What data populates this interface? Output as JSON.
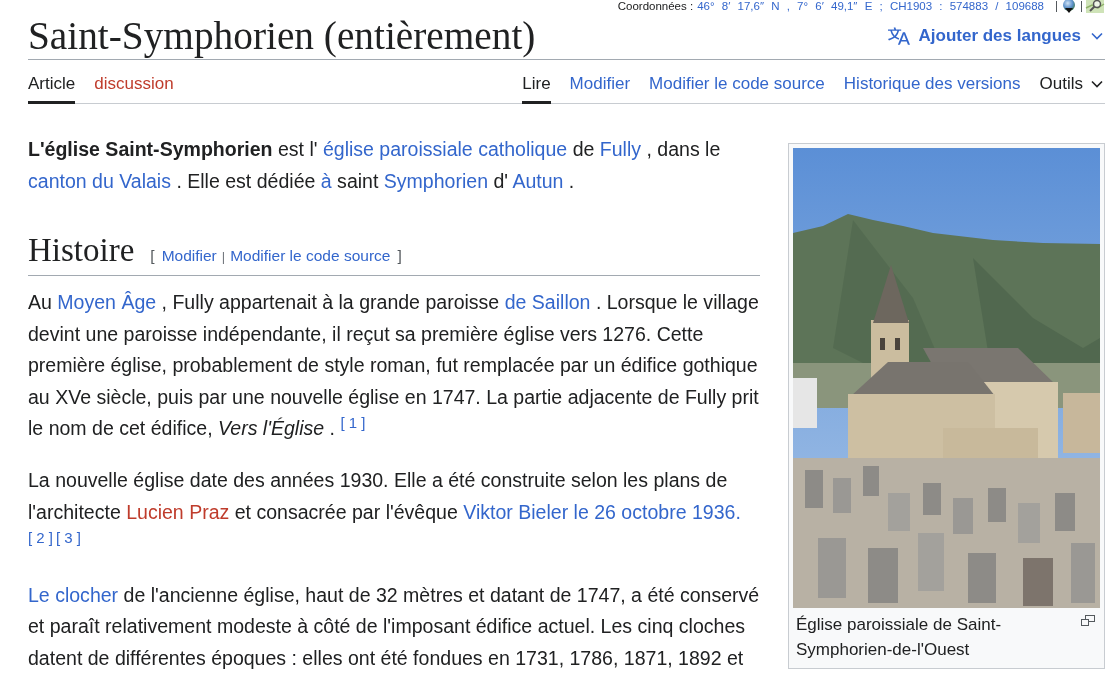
{
  "coordinates": {
    "label": "Coordonnées :",
    "value": "46° 8′ 17,6″ N , 7° 6′ 49,1″ E ; CH1903 : 574883 / 109688"
  },
  "header": {
    "title": "Saint-Symphorien (entièrement)",
    "languages_button": "Ajouter des langues"
  },
  "namespace_tabs": [
    {
      "label": "Article",
      "selected": true,
      "missing": false
    },
    {
      "label": "discussion",
      "selected": false,
      "missing": true
    }
  ],
  "view_tabs": [
    {
      "label": "Lire",
      "selected": true
    },
    {
      "label": "Modifier",
      "selected": false
    },
    {
      "label": "Modifier le code source",
      "selected": false
    },
    {
      "label": "Historique des versions",
      "selected": false
    }
  ],
  "tools_menu": {
    "label": "Outils"
  },
  "content": [
    {
      "kind": "paragraph",
      "segments": [
        {
          "kind": "bold",
          "text": "L'église Saint-Symphorien"
        },
        {
          "kind": "text",
          "text": " est l' "
        },
        {
          "kind": "link",
          "text": "église paroissiale catholique"
        },
        {
          "kind": "text",
          "text": " de "
        },
        {
          "kind": "link",
          "text": "Fully"
        },
        {
          "kind": "text",
          "text": " , dans le "
        },
        {
          "kind": "link",
          "text": "canton du Valais"
        },
        {
          "kind": "text",
          "text": " . Elle est dédiée "
        },
        {
          "kind": "link",
          "text": "à"
        },
        {
          "kind": "text",
          "text": " saint "
        },
        {
          "kind": "link",
          "text": "Symphorien"
        },
        {
          "kind": "text",
          "text": " d' "
        },
        {
          "kind": "link",
          "text": "Autun"
        },
        {
          "kind": "text",
          "text": " ."
        }
      ]
    },
    {
      "kind": "heading",
      "title": "Histoire",
      "bracket_open": "[",
      "edit_links": [
        "Modifier",
        "Modifier le code source"
      ],
      "separator": "|",
      "bracket_close": "]"
    },
    {
      "kind": "paragraph",
      "segments": [
        {
          "kind": "text",
          "text": "Au "
        },
        {
          "kind": "link",
          "text": "Moyen Âge"
        },
        {
          "kind": "text",
          "text": " , Fully appartenait à la grande paroisse "
        },
        {
          "kind": "link",
          "text": "de Saillon"
        },
        {
          "kind": "text",
          "text": " . Lorsque le village devint une paroisse indépendante, il reçut sa première église vers 1276. Cette première église, probablement de style roman, fut remplacée par un édifice gothique au XVe siècle, puis par une nouvelle église en 1747. La partie adjacente de Fully prit le nom de cet édifice, "
        },
        {
          "kind": "italic",
          "text": "Vers l'Église"
        },
        {
          "kind": "text",
          "text": " . "
        },
        {
          "kind": "ref",
          "text": "[ 1 ]"
        }
      ]
    },
    {
      "kind": "paragraph",
      "segments": [
        {
          "kind": "text",
          "text": "La nouvelle église date des années 1930. Elle a été construite selon les plans de l'architecte "
        },
        {
          "kind": "redlink",
          "text": "Lucien Praz"
        },
        {
          "kind": "text",
          "text": " et consacrée par l'évêque "
        },
        {
          "kind": "link",
          "text": "Viktor Bieler le 26 octobre 1936."
        },
        {
          "kind": "ref",
          "text": "[ 2 ]"
        },
        {
          "kind": "ref",
          "text": "[ 3 ]"
        }
      ]
    },
    {
      "kind": "paragraph",
      "segments": [
        {
          "kind": "link",
          "text": "Le clocher"
        },
        {
          "kind": "text",
          "text": " de l'ancienne église, haut de 32 mètres et datant de 1747, a été conservé et paraît relativement modeste à côté de l'imposant édifice actuel. Les cinq cloches datent de différentes époques : elles ont été fondues en 1731, 1786, 1871, 1892 et"
        }
      ]
    }
  ],
  "figure": {
    "caption": "Église paroissiale de Saint-Symphorien-de-l'Ouest"
  }
}
